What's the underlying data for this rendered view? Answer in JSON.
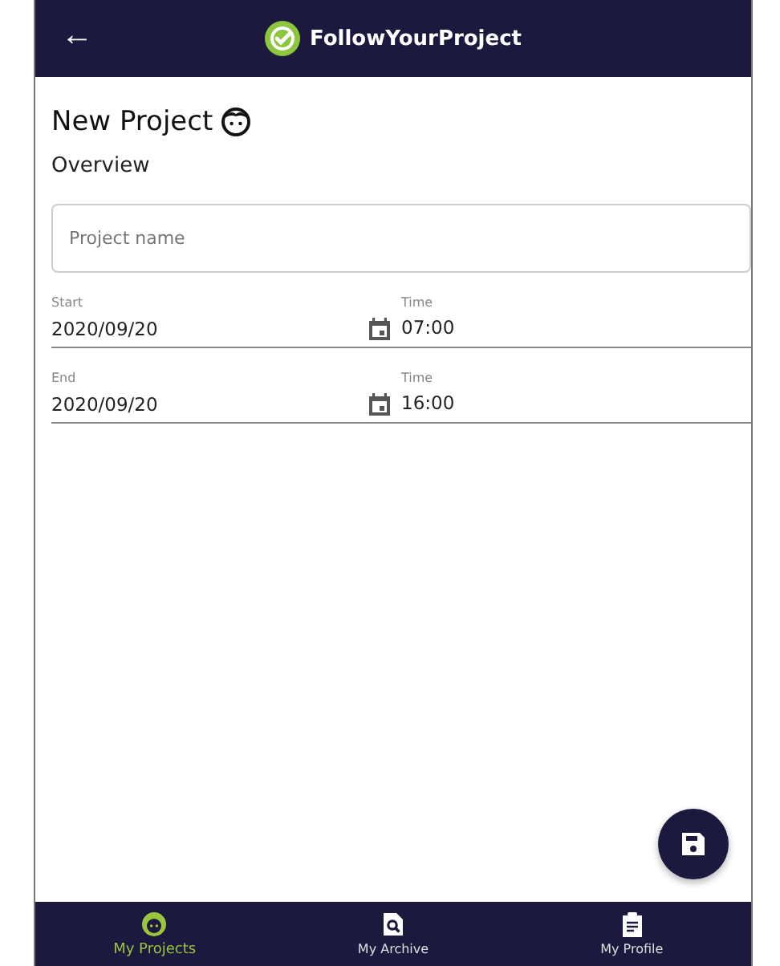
{
  "app_bar": {
    "back": "←",
    "title": "FollowYourProject"
  },
  "page": {
    "title": "New Project",
    "section": "Overview"
  },
  "project_name": {
    "placeholder": "Project name"
  },
  "schedule": [
    {
      "date_label": "Start",
      "date": "2020/09/20",
      "time_label": "Time",
      "time": "07:00"
    },
    {
      "date_label": "End",
      "date": "2020/09/20",
      "time_label": "Time",
      "time": "16:00"
    }
  ],
  "bottom_nav": [
    {
      "label": "My Projects",
      "selected": true
    },
    {
      "label": "My Archive",
      "selected": false
    },
    {
      "label": "My Profile",
      "selected": false
    }
  ]
}
